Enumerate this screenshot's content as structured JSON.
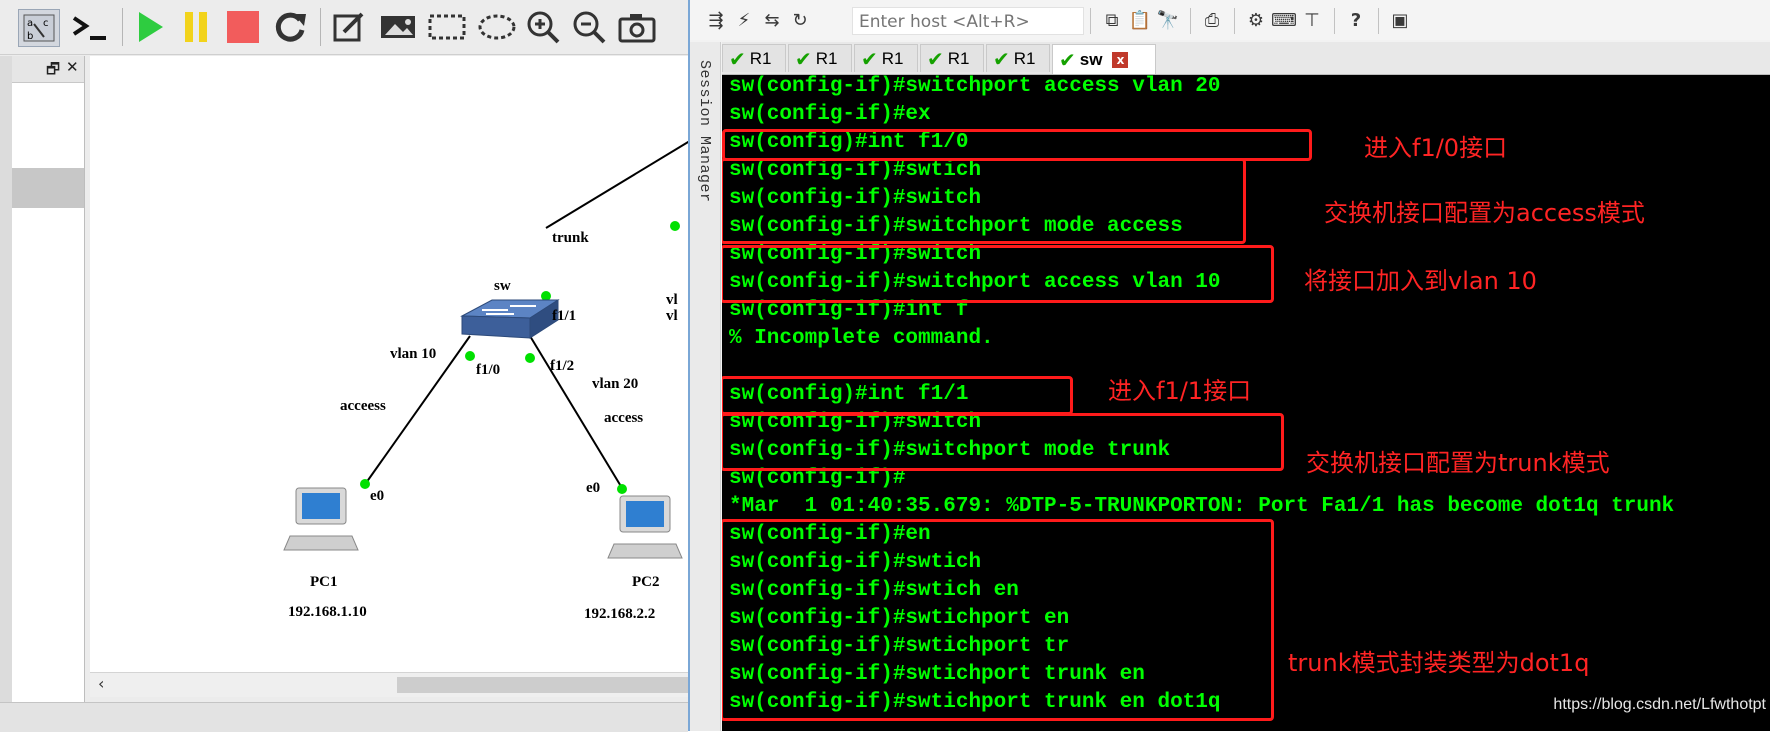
{
  "gns3": {
    "toolbar_icons": [
      "console-connect-icon",
      "show-interface-labels-icon",
      "console-all-icon",
      "start-icon",
      "suspend-icon",
      "stop-icon",
      "reload-icon",
      "add-note-icon",
      "insert-image-icon",
      "draw-rectangle-icon",
      "draw-ellipse-icon",
      "zoom-in-icon",
      "zoom-out-icon",
      "screenshot-icon"
    ],
    "dock": {
      "float_icon": "🗗",
      "close_icon": "✕"
    },
    "scroll_left": "‹",
    "topology": {
      "link_trunk": "trunk",
      "switch_name": "sw",
      "switch_port_uplink": "f1/1",
      "switch_port_pc1": "f1/0",
      "switch_port_pc2": "f1/2",
      "pc1_vlan": "vlan 10",
      "pc1_mode": "acceess",
      "pc2_vlan": "vlan 20",
      "pc2_mode": "access",
      "pc1_port": "e0",
      "pc2_port": "e0",
      "pc1_name": "PC1",
      "pc1_ip": "192.168.1.10",
      "pc2_name": "PC2",
      "pc2_ip": "192.168.2.2",
      "cut_label_1": "vl",
      "cut_label_2": "vl"
    },
    "colors": {
      "link_dot": "#00e000",
      "switch_blue": "#3d5f9a"
    }
  },
  "securecrt": {
    "host_placeholder": "Enter host <Alt+R>",
    "session_manager": "Session Manager",
    "tabs": [
      {
        "label": "R1",
        "status": "connected"
      },
      {
        "label": "R1",
        "status": "connected"
      },
      {
        "label": "R1",
        "status": "connected"
      },
      {
        "label": "R1",
        "status": "connected"
      },
      {
        "label": "R1",
        "status": "connected"
      },
      {
        "label": "sw",
        "status": "connected",
        "active": true
      }
    ],
    "tab_close": "x",
    "terminal_lines": [
      "sw(config-if)#switchport access vlan 20",
      "sw(config-if)#ex",
      "sw(config)#int f1/0",
      "sw(config-if)#swtich",
      "sw(config-if)#switch",
      "sw(config-if)#switchport mode access",
      "sw(config-if)#switch",
      "sw(config-if)#switchport access vlan 10",
      "sw(config-if)#int f",
      "% Incomplete command.",
      "",
      "sw(config)#int f1/1",
      "sw(config-if)#switch",
      "sw(config-if)#switchport mode trunk",
      "sw(config-if)#",
      "*Mar  1 01:40:35.679: %DTP-5-TRUNKPORTON: Port Fa1/1 has become dot1q trunk",
      "sw(config-if)#en",
      "sw(config-if)#swtich",
      "sw(config-if)#swtich en",
      "sw(config-if)#swtichport en",
      "sw(config-if)#swtichport tr",
      "sw(config-if)#swtichport trunk en",
      "sw(config-if)#swtichport trunk en dot1q"
    ],
    "annotations": [
      "进入f1/0接口",
      "交换机接口配置为access模式",
      "将接口加入到vlan 10",
      "进入f1/1接口",
      "交换机接口配置为trunk模式",
      "trunk模式封装类型为dot1q"
    ],
    "colors": {
      "terminal_bg": "#000000",
      "terminal_text": "#00ff00",
      "annotation": "#ff2424"
    }
  },
  "watermark": "https://blog.csdn.net/Lfwthotpt"
}
